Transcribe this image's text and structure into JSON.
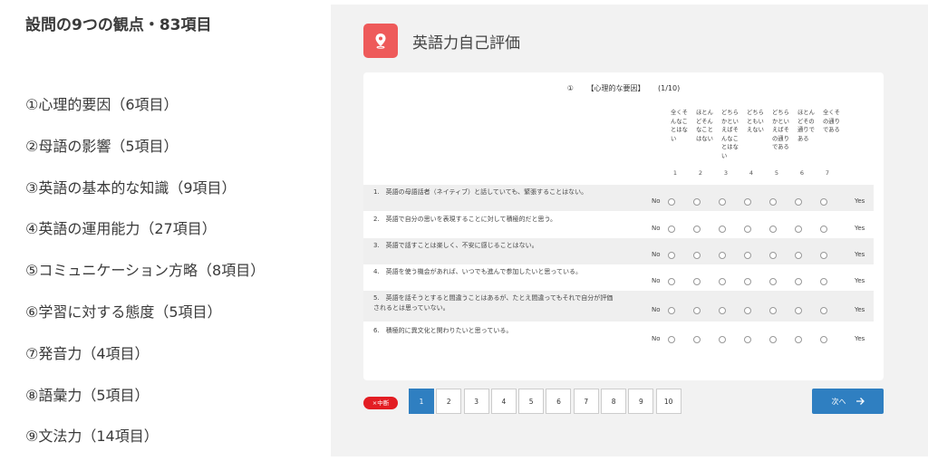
{
  "left": {
    "title": "設問の9つの観点・83項目",
    "categories": [
      "①心理的要因（6項目）",
      "②母語の影響（5項目）",
      "③英語の基本的な知識（9項目）",
      "④英語の運用能力（27項目）",
      "⑤コミュニケーション方略（8項目）",
      "⑥学習に対する態度（5項目）",
      "⑦発音力（4項目）",
      "⑧語彙力（5項目）",
      "⑨文法力（14項目）"
    ]
  },
  "app": {
    "title": "英語力自己評価",
    "icon": "location-pin-icon",
    "accent": "#ee5a5a"
  },
  "question_header": {
    "number": "①",
    "section": "【心理的な要因】",
    "progress": "(1/10)"
  },
  "scale": {
    "labels": [
      "全くそんなことはない",
      "ほとんどそんなことはない",
      "どちらかといえばそんなことはない",
      "どちらともいえない",
      "どちらかといえばその通りである",
      "ほとんどその通りである",
      "全くその通りである"
    ],
    "numbers": [
      "1",
      "2",
      "3",
      "4",
      "5",
      "6",
      "7"
    ],
    "low": "No",
    "high": "Yes"
  },
  "questions": [
    "1.　英語の母語話者（ネイティブ）と話していても、緊張することはない。",
    "2.　英語で自分の思いを表現することに対して積極的だと思う。",
    "3.　英語で話すことは楽しく、不安に感じることはない。",
    "4.　英語を使う機会があれば、いつでも進んで参加したいと思っている。",
    "5.　英語を話そうとすると間違うことはあるが、たとえ間違ってもそれで自分が評価されるとは思っていない。",
    "6.　積極的に異文化と関わりたいと思っている。"
  ],
  "footer": {
    "stop_label": "×中断",
    "pages": [
      "1",
      "2",
      "3",
      "4",
      "5",
      "6",
      "7",
      "8",
      "9",
      "10"
    ],
    "current_page": "1",
    "next_label": "次へ",
    "next_color": "#2f7fc1",
    "stop_color": "#e31d23"
  }
}
